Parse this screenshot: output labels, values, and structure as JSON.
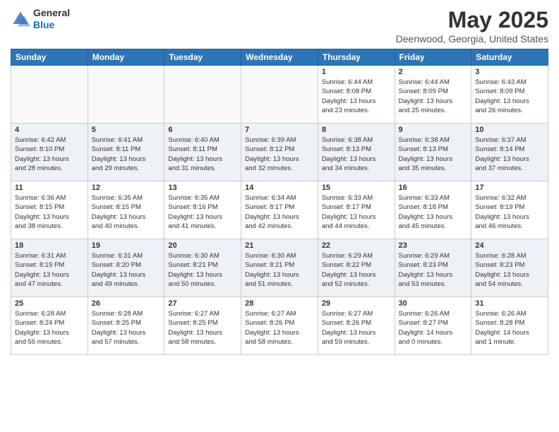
{
  "header": {
    "logo_general": "General",
    "logo_blue": "Blue",
    "month": "May 2025",
    "location": "Deenwood, Georgia, United States"
  },
  "days_of_week": [
    "Sunday",
    "Monday",
    "Tuesday",
    "Wednesday",
    "Thursday",
    "Friday",
    "Saturday"
  ],
  "weeks": [
    [
      {
        "day": "",
        "info": ""
      },
      {
        "day": "",
        "info": ""
      },
      {
        "day": "",
        "info": ""
      },
      {
        "day": "",
        "info": ""
      },
      {
        "day": "1",
        "info": "Sunrise: 6:44 AM\nSunset: 8:08 PM\nDaylight: 13 hours\nand 23 minutes."
      },
      {
        "day": "2",
        "info": "Sunrise: 6:44 AM\nSunset: 8:09 PM\nDaylight: 13 hours\nand 25 minutes."
      },
      {
        "day": "3",
        "info": "Sunrise: 6:43 AM\nSunset: 8:09 PM\nDaylight: 13 hours\nand 26 minutes."
      }
    ],
    [
      {
        "day": "4",
        "info": "Sunrise: 6:42 AM\nSunset: 8:10 PM\nDaylight: 13 hours\nand 28 minutes."
      },
      {
        "day": "5",
        "info": "Sunrise: 6:41 AM\nSunset: 8:11 PM\nDaylight: 13 hours\nand 29 minutes."
      },
      {
        "day": "6",
        "info": "Sunrise: 6:40 AM\nSunset: 8:11 PM\nDaylight: 13 hours\nand 31 minutes."
      },
      {
        "day": "7",
        "info": "Sunrise: 6:39 AM\nSunset: 8:12 PM\nDaylight: 13 hours\nand 32 minutes."
      },
      {
        "day": "8",
        "info": "Sunrise: 6:38 AM\nSunset: 8:13 PM\nDaylight: 13 hours\nand 34 minutes."
      },
      {
        "day": "9",
        "info": "Sunrise: 6:38 AM\nSunset: 8:13 PM\nDaylight: 13 hours\nand 35 minutes."
      },
      {
        "day": "10",
        "info": "Sunrise: 6:37 AM\nSunset: 8:14 PM\nDaylight: 13 hours\nand 37 minutes."
      }
    ],
    [
      {
        "day": "11",
        "info": "Sunrise: 6:36 AM\nSunset: 8:15 PM\nDaylight: 13 hours\nand 38 minutes."
      },
      {
        "day": "12",
        "info": "Sunrise: 6:35 AM\nSunset: 8:15 PM\nDaylight: 13 hours\nand 40 minutes."
      },
      {
        "day": "13",
        "info": "Sunrise: 6:35 AM\nSunset: 8:16 PM\nDaylight: 13 hours\nand 41 minutes."
      },
      {
        "day": "14",
        "info": "Sunrise: 6:34 AM\nSunset: 8:17 PM\nDaylight: 13 hours\nand 42 minutes."
      },
      {
        "day": "15",
        "info": "Sunrise: 6:33 AM\nSunset: 8:17 PM\nDaylight: 13 hours\nand 44 minutes."
      },
      {
        "day": "16",
        "info": "Sunrise: 6:33 AM\nSunset: 8:18 PM\nDaylight: 13 hours\nand 45 minutes."
      },
      {
        "day": "17",
        "info": "Sunrise: 6:32 AM\nSunset: 8:19 PM\nDaylight: 13 hours\nand 46 minutes."
      }
    ],
    [
      {
        "day": "18",
        "info": "Sunrise: 6:31 AM\nSunset: 8:19 PM\nDaylight: 13 hours\nand 47 minutes."
      },
      {
        "day": "19",
        "info": "Sunrise: 6:31 AM\nSunset: 8:20 PM\nDaylight: 13 hours\nand 49 minutes."
      },
      {
        "day": "20",
        "info": "Sunrise: 6:30 AM\nSunset: 8:21 PM\nDaylight: 13 hours\nand 50 minutes."
      },
      {
        "day": "21",
        "info": "Sunrise: 6:30 AM\nSunset: 8:21 PM\nDaylight: 13 hours\nand 51 minutes."
      },
      {
        "day": "22",
        "info": "Sunrise: 6:29 AM\nSunset: 8:22 PM\nDaylight: 13 hours\nand 52 minutes."
      },
      {
        "day": "23",
        "info": "Sunrise: 6:29 AM\nSunset: 8:23 PM\nDaylight: 13 hours\nand 53 minutes."
      },
      {
        "day": "24",
        "info": "Sunrise: 6:28 AM\nSunset: 8:23 PM\nDaylight: 13 hours\nand 54 minutes."
      }
    ],
    [
      {
        "day": "25",
        "info": "Sunrise: 6:28 AM\nSunset: 8:24 PM\nDaylight: 13 hours\nand 55 minutes."
      },
      {
        "day": "26",
        "info": "Sunrise: 6:28 AM\nSunset: 8:25 PM\nDaylight: 13 hours\nand 57 minutes."
      },
      {
        "day": "27",
        "info": "Sunrise: 6:27 AM\nSunset: 8:25 PM\nDaylight: 13 hours\nand 58 minutes."
      },
      {
        "day": "28",
        "info": "Sunrise: 6:27 AM\nSunset: 8:26 PM\nDaylight: 13 hours\nand 58 minutes."
      },
      {
        "day": "29",
        "info": "Sunrise: 6:27 AM\nSunset: 8:26 PM\nDaylight: 13 hours\nand 59 minutes."
      },
      {
        "day": "30",
        "info": "Sunrise: 6:26 AM\nSunset: 8:27 PM\nDaylight: 14 hours\nand 0 minutes."
      },
      {
        "day": "31",
        "info": "Sunrise: 6:26 AM\nSunset: 8:28 PM\nDaylight: 14 hours\nand 1 minute."
      }
    ]
  ]
}
